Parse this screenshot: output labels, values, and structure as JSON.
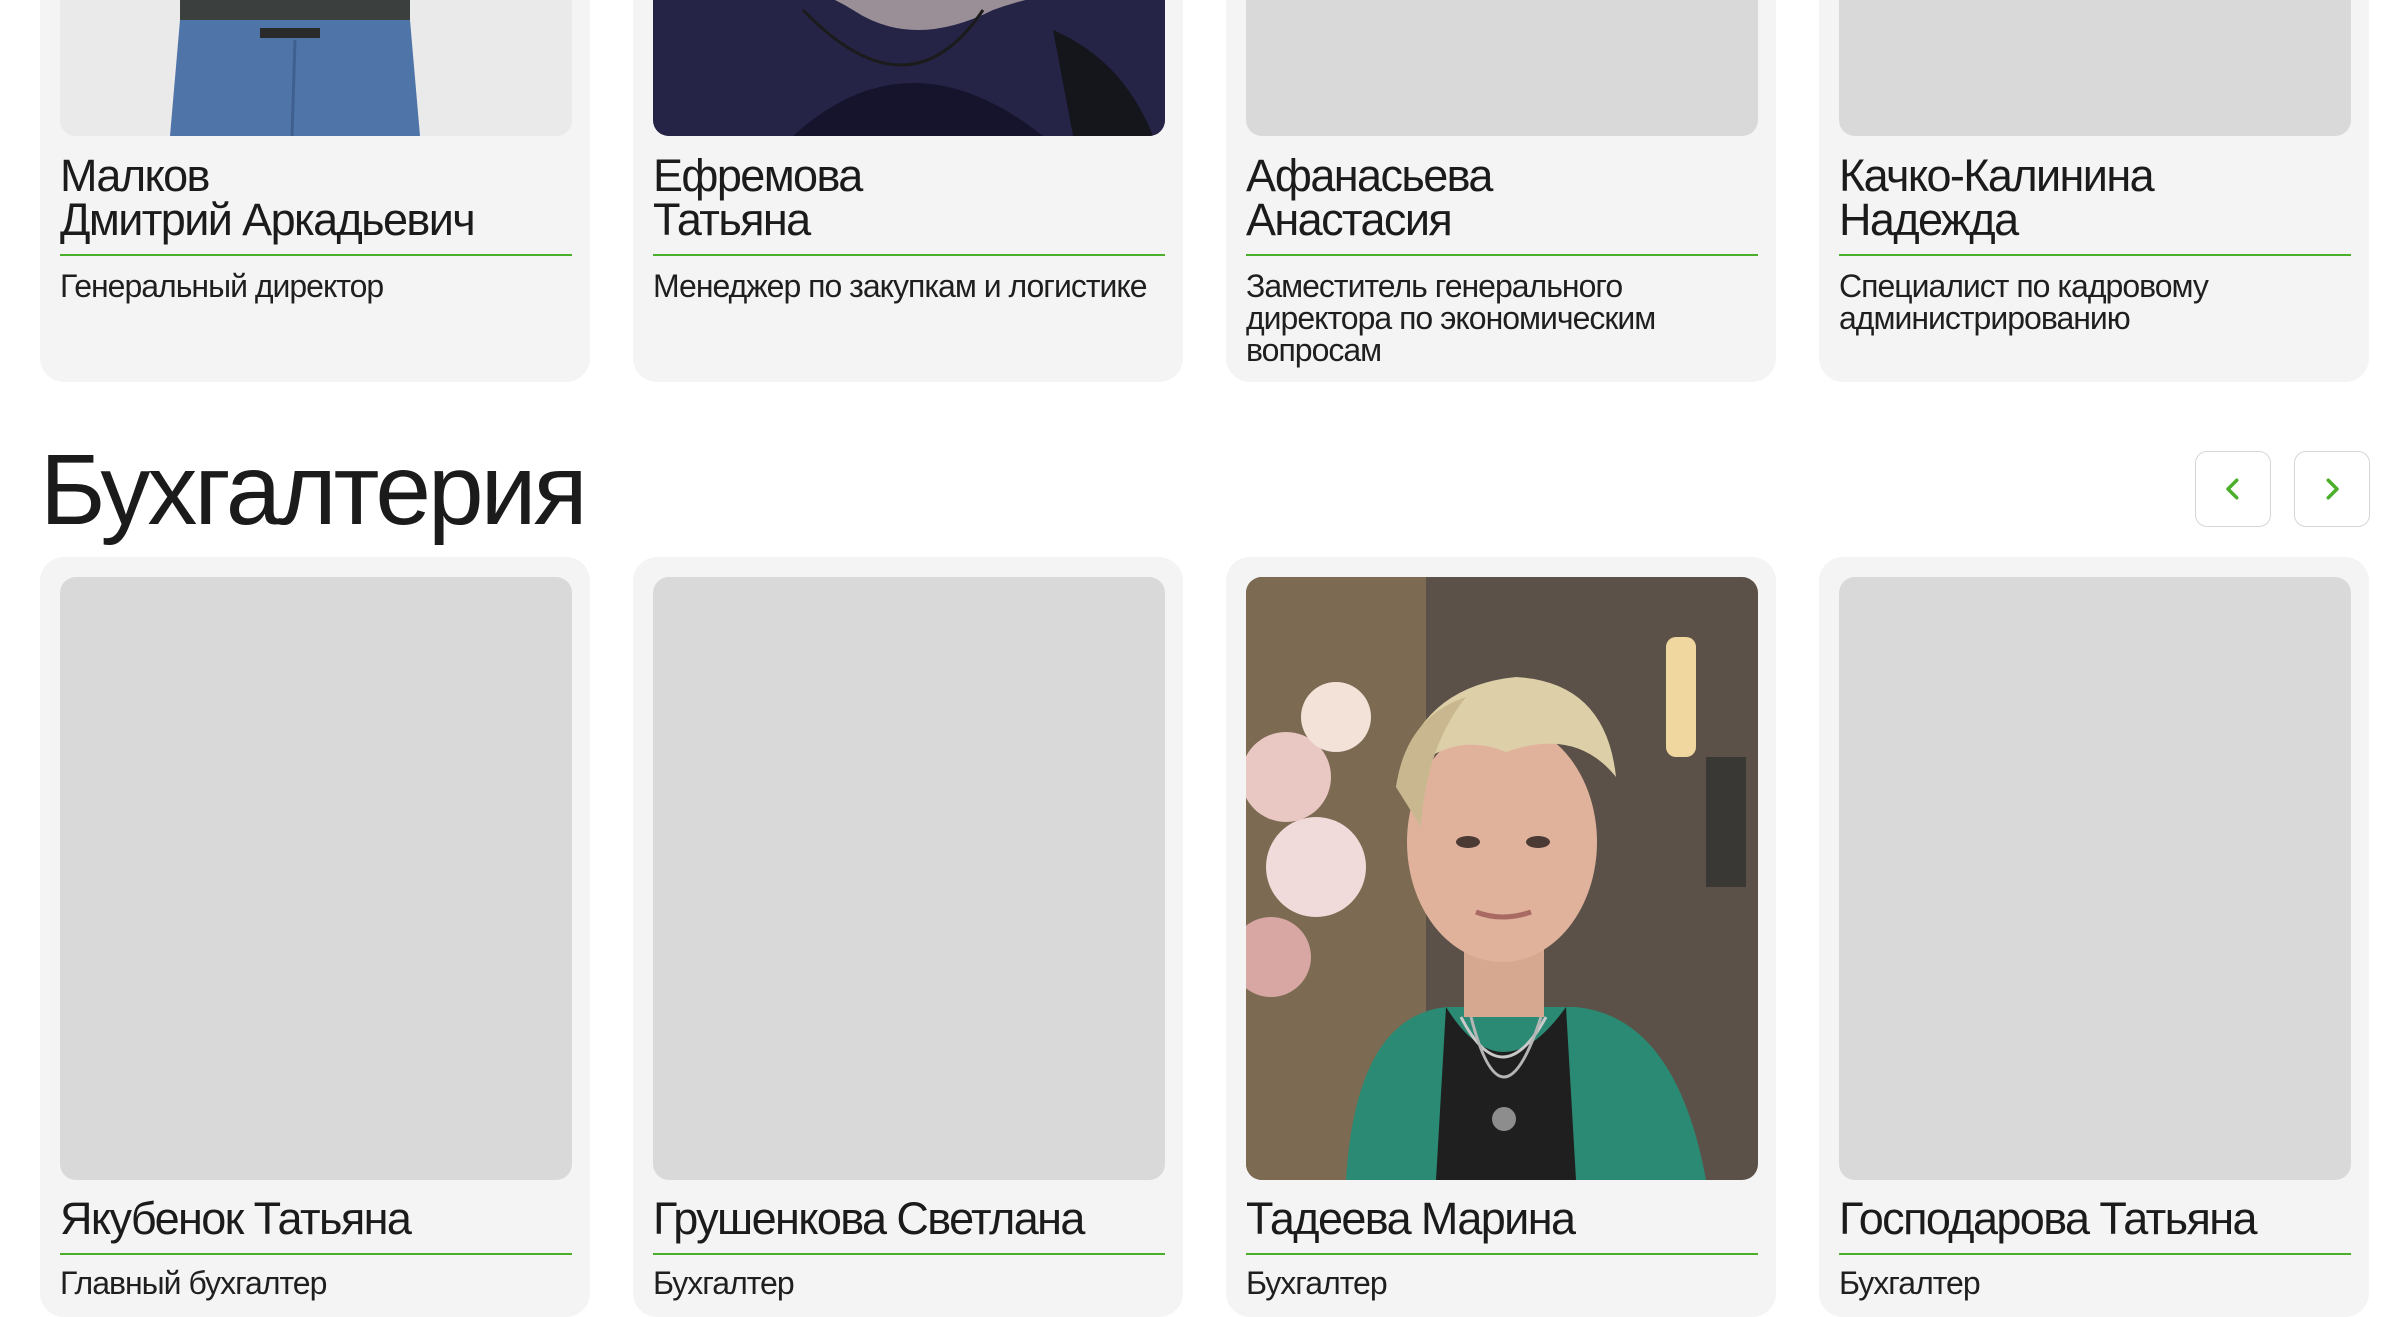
{
  "leadership": [
    {
      "name": "Малков\nДмитрий Аркадьевич",
      "role": "Генеральный директор",
      "photo": "person-photo"
    },
    {
      "name": "Ефремова\nТатьяна",
      "role": "Менеджер по закупкам и логистике",
      "photo": "person-photo"
    },
    {
      "name": "Афанасьева\nАнастасия",
      "role": "Заместитель генерального директора по экономическим вопросам",
      "photo": "placeholder"
    },
    {
      "name": "Качко-Калинина\nНадежда",
      "role": "Специалист по кадровому администрированию",
      "photo": "placeholder"
    }
  ],
  "accounting": {
    "title": "Бухгалтерия",
    "nav": {
      "prev_icon": "chevron-left-icon",
      "next_icon": "chevron-right-icon",
      "accent": "#4caf2c"
    },
    "members": [
      {
        "name": "Якубенок Татьяна",
        "role": "Главный бухгалтер",
        "photo": "placeholder"
      },
      {
        "name": "Грушенкова Светлана",
        "role": "Бухгалтер",
        "photo": "placeholder"
      },
      {
        "name": "Тадеева Марина",
        "role": "Бухгалтер",
        "photo": "person-photo"
      },
      {
        "name": "Господарова Татьяна",
        "role": "Бухгалтер",
        "photo": "placeholder"
      }
    ]
  }
}
